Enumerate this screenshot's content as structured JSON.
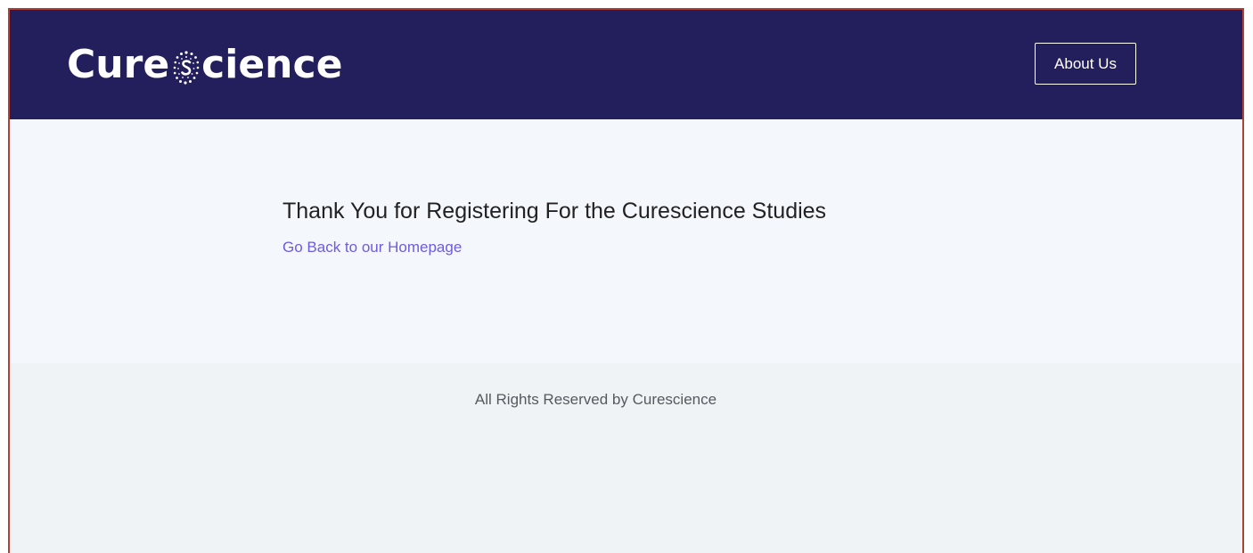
{
  "header": {
    "logo": {
      "part1": "Cure",
      "part2": "cience",
      "icon": "s-dots-logo-icon"
    },
    "about_button_label": "About Us"
  },
  "main": {
    "title": "Thank You for Registering For the Curescience Studies",
    "home_link_label": "Go Back to our Homepage"
  },
  "footer": {
    "text": "All Rights Reserved by Curescience"
  },
  "colors": {
    "header_bg": "#231f5c",
    "link": "#6c5ce0",
    "page_bg": "#f4f7fc",
    "footer_bg": "#f0f3f6",
    "frame_border": "#b0403c"
  }
}
